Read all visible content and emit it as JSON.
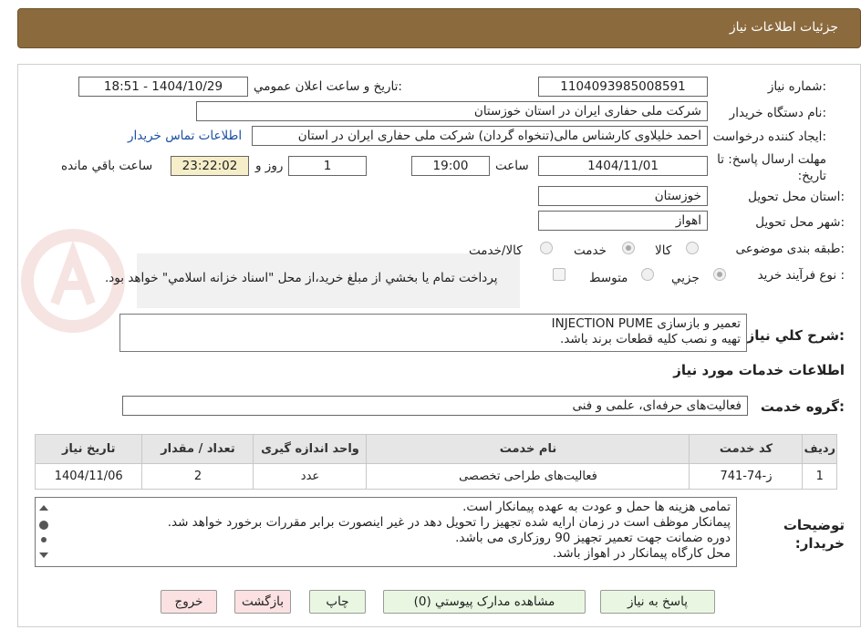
{
  "header": {
    "title": "جزئیات اطلاعات نیاز"
  },
  "fields": {
    "need_number_label": "شماره نیاز:",
    "need_number": "1104093985008591",
    "announce_label": "تاریخ و ساعت اعلان عمومي:",
    "announce_value": "1404/10/29 - 18:51",
    "buyer_org_label": "نام دستگاه خريدار:",
    "buyer_org": "شرکت ملی حفاری ایران در استان خوزستان",
    "creator_label": "ایجاد کننده درخواست:",
    "creator": "احمد خلیلاوی کارشناس مالی(تنخواه گردان) شرکت ملی حفاری ایران در استان",
    "contact_link": "اطلاعات تماس خريدار",
    "deadline_label": "مهلت ارسال پاسخ: تا تاريخ:",
    "deadline_date": "1404/11/01",
    "time_label": "ساعت",
    "deadline_time": "19:00",
    "days_value": "1",
    "days_label": "روز و",
    "remaining_time": "23:22:02",
    "remaining_label": "ساعت باقي مانده",
    "province_label": "استان محل تحويل:",
    "province": "خوزستان",
    "city_label": "شهر محل تحويل:",
    "city": "اهواز",
    "category_label": "طبقه بندی موضوعی:",
    "category_options": [
      "کالا",
      "خدمت",
      "کالا/خدمت"
    ],
    "process_label": "نوع فرآيند خريد :",
    "process_options": [
      "جزيي",
      "متوسط"
    ],
    "payment_note": "پرداخت تمام يا بخشي از مبلغ خريد،از محل \"اسناد خزانه اسلامي\" خواهد بود."
  },
  "description": {
    "label": "شرح کلي نياز:",
    "line1": "تعمیر و بازسازی INJECTION PUME",
    "line2": "تهیه و نصب کلیه قطعات برند باشد."
  },
  "services": {
    "section_title": "اطلاعات خدمات مورد نياز",
    "group_label": "گروه خدمت:",
    "group_value": "فعالیت‌های حرفه‌ای، علمی و فنی",
    "table": {
      "headers": [
        "رديف",
        "کد خدمت",
        "نام خدمت",
        "واحد اندازه گيری",
        "تعداد / مقدار",
        "تاريخ نياز"
      ],
      "rows": [
        [
          "1",
          "ز-74-741",
          "فعالیت‌های طراحی تخصصی",
          "عدد",
          "2",
          "1404/11/06"
        ]
      ]
    }
  },
  "buyer_notes": {
    "label": "توضيحات خريدار:",
    "lines": [
      "تمامی هزینه ها حمل و عودت به عهده پیمانکار است.",
      "پیمانکار موظف است در زمان ارایه شده تجهیز را تحویل دهد در غیر اینصورت برابر مقررات برخورد خواهد شد.",
      "دوره ضمانت جهت تعمیر تجهیز  90 روزکاری می باشد.",
      "محل کارگاه پیمانکار در اهواز باشد."
    ]
  },
  "buttons": {
    "reply": "پاسخ به نياز",
    "docs": "مشاهده مدارک پيوستي (0)",
    "print": "چاپ",
    "back": "بازگشت",
    "exit": "خروج"
  },
  "colors": {
    "title_bg": "#8b6a3e",
    "button_green": "#e9f7e2",
    "button_red": "#fbe1e1",
    "link": "#1a4fa3"
  }
}
